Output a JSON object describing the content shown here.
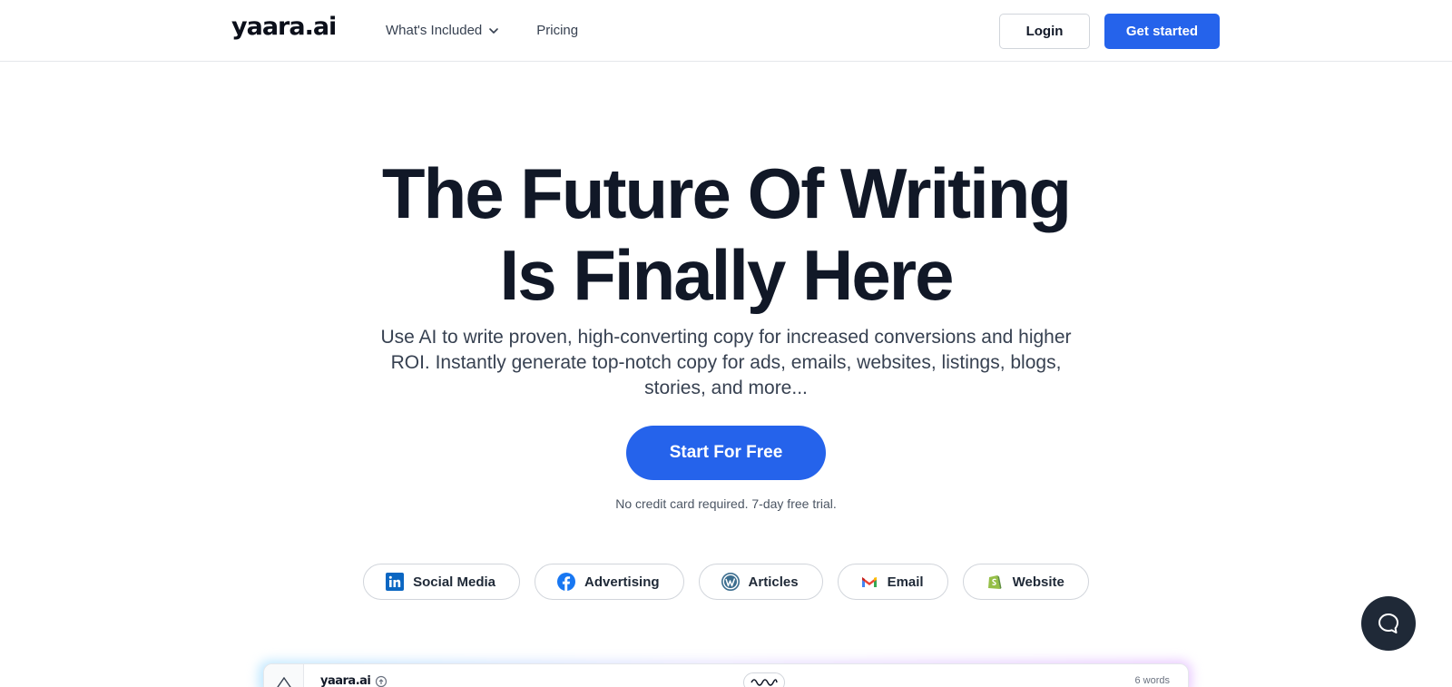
{
  "header": {
    "logo": "yaara.ai",
    "nav": [
      {
        "label": "What's Included",
        "has_dropdown": true
      },
      {
        "label": "Pricing",
        "has_dropdown": false
      }
    ],
    "login_label": "Login",
    "get_started_label": "Get started"
  },
  "hero": {
    "title_line1": "The Future Of Writing",
    "title_line2": "Is Finally Here",
    "subtitle": "Use AI to write proven, high-converting copy for increased conversions and higher ROI. Instantly generate top-notch copy for ads, emails, websites, listings, blogs, stories, and more...",
    "cta_label": "Start For Free",
    "note": "No credit card required. 7-day free trial."
  },
  "categories": [
    {
      "label": "Social Media",
      "icon": "linkedin-icon"
    },
    {
      "label": "Advertising",
      "icon": "facebook-icon"
    },
    {
      "label": "Articles",
      "icon": "wordpress-icon"
    },
    {
      "label": "Email",
      "icon": "gmail-icon"
    },
    {
      "label": "Website",
      "icon": "shopify-icon"
    }
  ],
  "preview": {
    "logo": "yaara.ai",
    "word_count": "6 words"
  },
  "colors": {
    "accent": "#2563eb",
    "text_dark": "#111827",
    "chat_bg": "#1f2937"
  }
}
